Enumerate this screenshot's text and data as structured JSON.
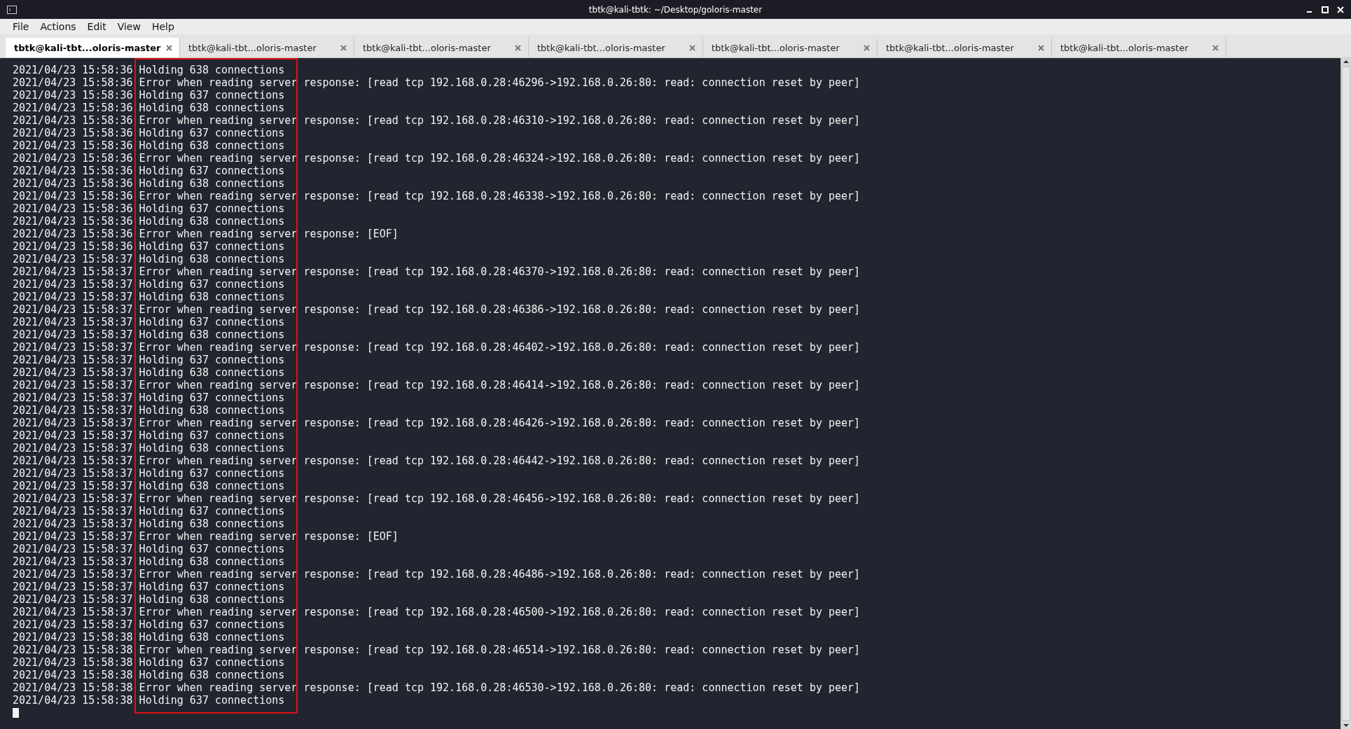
{
  "window": {
    "title": "tbtk@kali-tbtk: ~/Desktop/goloris-master"
  },
  "menu": [
    "File",
    "Actions",
    "Edit",
    "View",
    "Help"
  ],
  "tabs": [
    {
      "label": "tbtk@kali-tbt...oloris-master",
      "selected": true
    },
    {
      "label": "tbtk@kali-tbt...oloris-master",
      "selected": false
    },
    {
      "label": "tbtk@kali-tbt...oloris-master",
      "selected": false
    },
    {
      "label": "tbtk@kali-tbt...oloris-master",
      "selected": false
    },
    {
      "label": "tbtk@kali-tbt...oloris-master",
      "selected": false
    },
    {
      "label": "tbtk@kali-tbt...oloris-master",
      "selected": false
    },
    {
      "label": "tbtk@kali-tbt...oloris-master",
      "selected": false
    }
  ],
  "terminal": {
    "lines": [
      "2021/04/23 15:58:36 Holding 638 connections",
      "2021/04/23 15:58:36 Error when reading server response: [read tcp 192.168.0.28:46296->192.168.0.26:80: read: connection reset by peer]",
      "2021/04/23 15:58:36 Holding 637 connections",
      "2021/04/23 15:58:36 Holding 638 connections",
      "2021/04/23 15:58:36 Error when reading server response: [read tcp 192.168.0.28:46310->192.168.0.26:80: read: connection reset by peer]",
      "2021/04/23 15:58:36 Holding 637 connections",
      "2021/04/23 15:58:36 Holding 638 connections",
      "2021/04/23 15:58:36 Error when reading server response: [read tcp 192.168.0.28:46324->192.168.0.26:80: read: connection reset by peer]",
      "2021/04/23 15:58:36 Holding 637 connections",
      "2021/04/23 15:58:36 Holding 638 connections",
      "2021/04/23 15:58:36 Error when reading server response: [read tcp 192.168.0.28:46338->192.168.0.26:80: read: connection reset by peer]",
      "2021/04/23 15:58:36 Holding 637 connections",
      "2021/04/23 15:58:36 Holding 638 connections",
      "2021/04/23 15:58:36 Error when reading server response: [EOF]",
      "2021/04/23 15:58:36 Holding 637 connections",
      "2021/04/23 15:58:37 Holding 638 connections",
      "2021/04/23 15:58:37 Error when reading server response: [read tcp 192.168.0.28:46370->192.168.0.26:80: read: connection reset by peer]",
      "2021/04/23 15:58:37 Holding 637 connections",
      "2021/04/23 15:58:37 Holding 638 connections",
      "2021/04/23 15:58:37 Error when reading server response: [read tcp 192.168.0.28:46386->192.168.0.26:80: read: connection reset by peer]",
      "2021/04/23 15:58:37 Holding 637 connections",
      "2021/04/23 15:58:37 Holding 638 connections",
      "2021/04/23 15:58:37 Error when reading server response: [read tcp 192.168.0.28:46402->192.168.0.26:80: read: connection reset by peer]",
      "2021/04/23 15:58:37 Holding 637 connections",
      "2021/04/23 15:58:37 Holding 638 connections",
      "2021/04/23 15:58:37 Error when reading server response: [read tcp 192.168.0.28:46414->192.168.0.26:80: read: connection reset by peer]",
      "2021/04/23 15:58:37 Holding 637 connections",
      "2021/04/23 15:58:37 Holding 638 connections",
      "2021/04/23 15:58:37 Error when reading server response: [read tcp 192.168.0.28:46426->192.168.0.26:80: read: connection reset by peer]",
      "2021/04/23 15:58:37 Holding 637 connections",
      "2021/04/23 15:58:37 Holding 638 connections",
      "2021/04/23 15:58:37 Error when reading server response: [read tcp 192.168.0.28:46442->192.168.0.26:80: read: connection reset by peer]",
      "2021/04/23 15:58:37 Holding 637 connections",
      "2021/04/23 15:58:37 Holding 638 connections",
      "2021/04/23 15:58:37 Error when reading server response: [read tcp 192.168.0.28:46456->192.168.0.26:80: read: connection reset by peer]",
      "2021/04/23 15:58:37 Holding 637 connections",
      "2021/04/23 15:58:37 Holding 638 connections",
      "2021/04/23 15:58:37 Error when reading server response: [EOF]",
      "2021/04/23 15:58:37 Holding 637 connections",
      "2021/04/23 15:58:37 Holding 638 connections",
      "2021/04/23 15:58:37 Error when reading server response: [read tcp 192.168.0.28:46486->192.168.0.26:80: read: connection reset by peer]",
      "2021/04/23 15:58:37 Holding 637 connections",
      "2021/04/23 15:58:37 Holding 638 connections",
      "2021/04/23 15:58:37 Error when reading server response: [read tcp 192.168.0.28:46500->192.168.0.26:80: read: connection reset by peer]",
      "2021/04/23 15:58:37 Holding 637 connections",
      "2021/04/23 15:58:38 Holding 638 connections",
      "2021/04/23 15:58:38 Error when reading server response: [read tcp 192.168.0.28:46514->192.168.0.26:80: read: connection reset by peer]",
      "2021/04/23 15:58:38 Holding 637 connections",
      "2021/04/23 15:58:38 Holding 638 connections",
      "2021/04/23 15:58:38 Error when reading server response: [read tcp 192.168.0.28:46530->192.168.0.26:80: read: connection reset by peer]",
      "2021/04/23 15:58:38 Holding 637 connections"
    ]
  }
}
